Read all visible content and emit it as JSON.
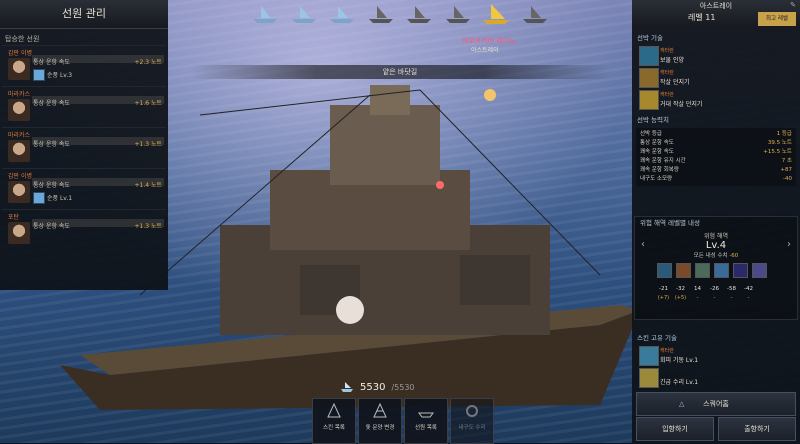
{
  "left_panel": {
    "title": "선원 관리",
    "subtitle": "탑승한 선원",
    "crew": [
      {
        "role": "갑판 이병",
        "stat": "통상 운항 속도",
        "value": "+2.3 노트",
        "skill": "순풍 Lv.3"
      },
      {
        "role": "마라카스",
        "stat": "통상 운항 속도",
        "value": "+1.6 노트",
        "skill": ""
      },
      {
        "role": "마라카스",
        "stat": "통상 운항 속도",
        "value": "+1.3 노트",
        "skill": ""
      },
      {
        "role": "갑판 이병",
        "stat": "통상 운항 속도",
        "value": "+1.4 노트",
        "skill": "순풍 Lv.1"
      },
      {
        "role": "포탄",
        "stat": "통상 운항 속도",
        "value": "+1.3 노트",
        "skill": ""
      }
    ]
  },
  "top_ships": [
    "ship-icon",
    "ship-icon",
    "ship-icon",
    "locked-ship-icon",
    "locked-ship-icon",
    "locked-ship-icon",
    "selected-ship-icon",
    "ship-icon"
  ],
  "ship": {
    "banner": "얕은 바닷길",
    "name": "아우프리아 레이노",
    "owner": "아스트레이",
    "durability": "5530",
    "durability_max": "/5530"
  },
  "bottom_tabs": [
    {
      "label": "스킨 목록",
      "disabled": false
    },
    {
      "label": "돛 문양 변경",
      "disabled": false
    },
    {
      "label": "선원 목록",
      "disabled": false
    },
    {
      "label": "내구도 수리",
      "disabled": true
    }
  ],
  "right_panel": {
    "ship_name": "아스트레이",
    "level": "레벨 11",
    "level_button": "최고 레벨",
    "skills_title": "선박 기술",
    "skills": [
      {
        "tag": "캐터란",
        "name": "보물 인양"
      },
      {
        "tag": "캐터란",
        "name": "작살 던지기"
      },
      {
        "tag": "캐터란",
        "name": "거대 작살 던지기"
      }
    ],
    "abilities_title": "선박 능력치",
    "abilities": [
      {
        "name": "선박 등급",
        "value": "1 등급"
      },
      {
        "name": "통상 운항 속도",
        "value": "39.5 노트"
      },
      {
        "name": "쾌속 운항 속도",
        "value": "+15.5 노트"
      },
      {
        "name": "쾌속 운항 유지 시간",
        "value": "7 초"
      },
      {
        "name": "쾌속 운항 회복량",
        "value": "+87"
      },
      {
        "name": "내구도 소모량",
        "value": "-40"
      }
    ],
    "danger_title": "위험 해역 레벨별 내성",
    "danger_sub": "위험 해역",
    "danger_level": "Lv.4",
    "danger_all_prefix": "모든 내성 수치",
    "danger_all_value": "-60",
    "danger_values": [
      "-21",
      "-32",
      "14",
      "-26",
      "-58",
      "-42"
    ],
    "danger_extra": [
      "(+7)",
      "(+5)",
      "-",
      "-",
      "-",
      "-"
    ],
    "emergency_title": "스킨 고유 기술",
    "emergency_skills": [
      {
        "tag": "캐터란",
        "name": "회피 기동 Lv.1"
      },
      {
        "tag": "",
        "name": "긴급 수리 Lv.1"
      }
    ],
    "btn_main": "스쿼어홈",
    "btn_board": "입항하기",
    "btn_depart": "출항하기"
  },
  "colors": {
    "accent": "#c8a24a",
    "value": "#e0b050",
    "highlight": "#e07a3a"
  }
}
